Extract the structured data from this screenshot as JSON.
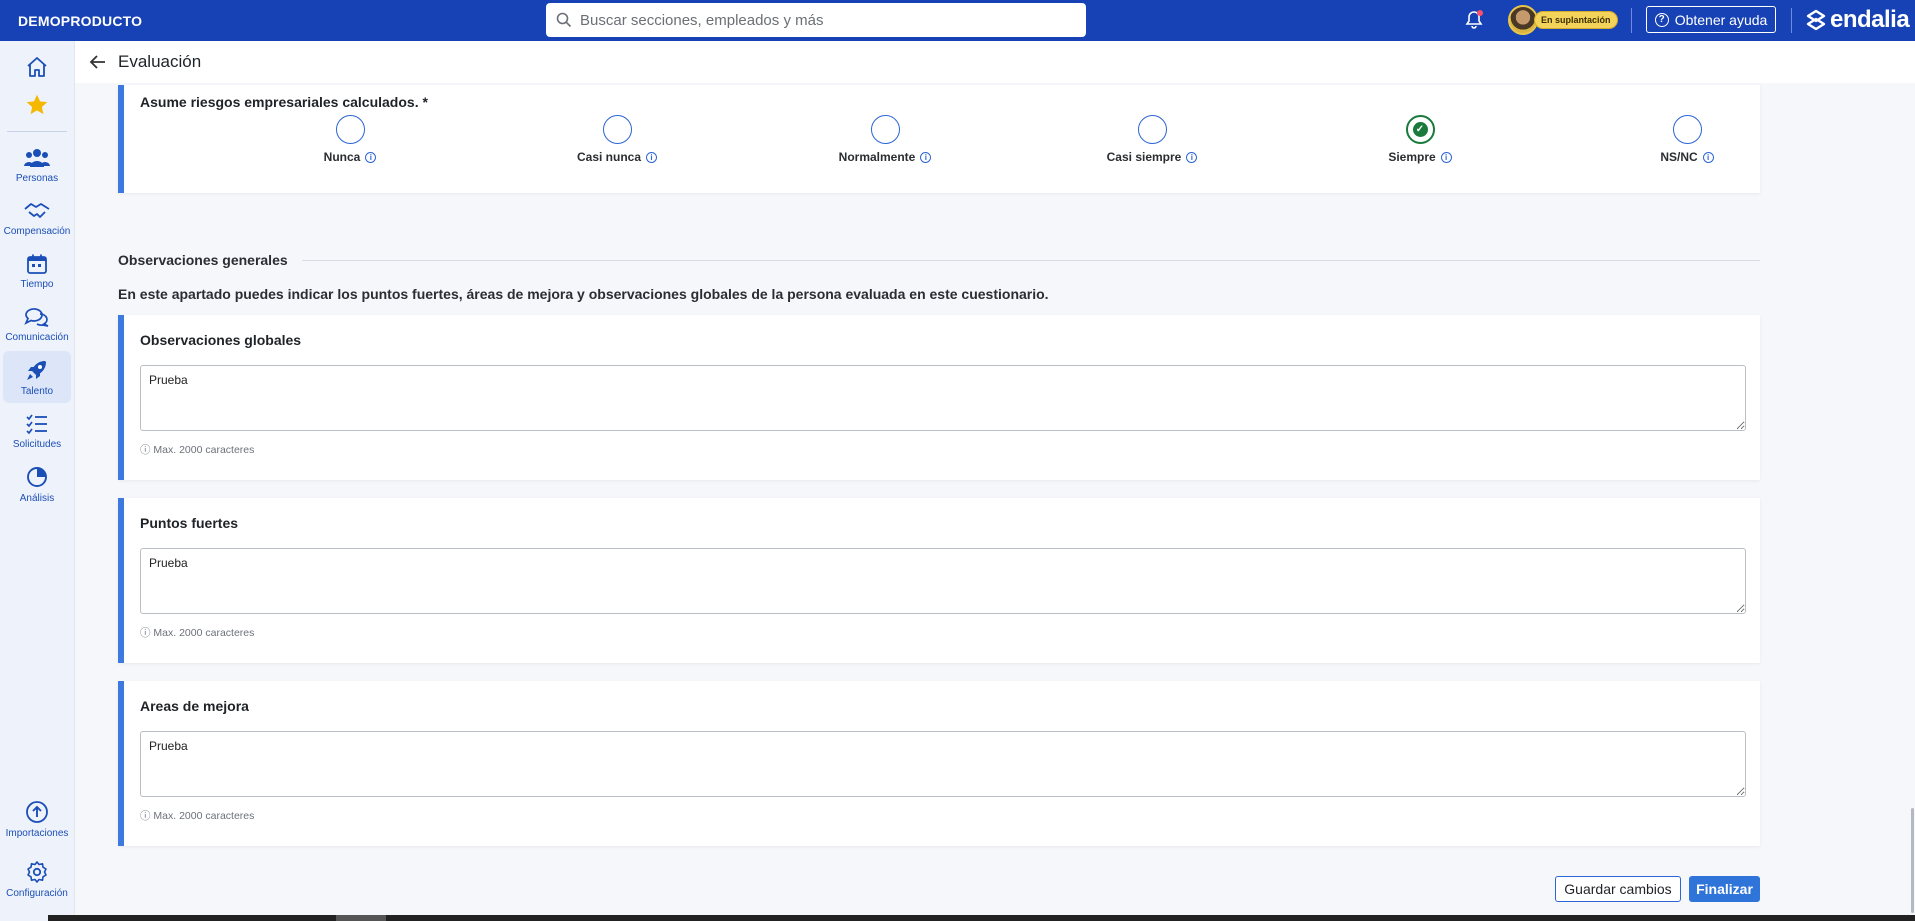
{
  "app": {
    "brand": "DEMOPRODUCTO",
    "logo_text": "endalia"
  },
  "search": {
    "placeholder": "Buscar secciones, empleados y más"
  },
  "topbar": {
    "impersonation_badge": "En suplantación",
    "help_label": "Obtener ayuda"
  },
  "sidebar": {
    "items": [
      {
        "label": "",
        "icon": "home-icon"
      },
      {
        "label": "",
        "icon": "star-icon"
      },
      {
        "label": "Personas",
        "icon": "people-icon"
      },
      {
        "label": "Compensación",
        "icon": "handshake-icon"
      },
      {
        "label": "Tiempo",
        "icon": "calendar-icon"
      },
      {
        "label": "Comunicación",
        "icon": "chat-icon"
      },
      {
        "label": "Talento",
        "icon": "rocket-icon",
        "active": true
      },
      {
        "label": "Solicitudes",
        "icon": "checklist-icon"
      },
      {
        "label": "Análisis",
        "icon": "pie-chart-icon"
      },
      {
        "label": "Importaciones",
        "icon": "upload-icon"
      },
      {
        "label": "Configuración",
        "icon": "gear-icon"
      }
    ]
  },
  "page": {
    "title": "Evaluación"
  },
  "question": {
    "title": "Asume riesgos empresariales calculados. *",
    "options": [
      {
        "label": "Nunca",
        "checked": false
      },
      {
        "label": "Casi nunca",
        "checked": false
      },
      {
        "label": "Normalmente",
        "checked": false
      },
      {
        "label": "Casi siempre",
        "checked": false
      },
      {
        "label": "Siempre",
        "checked": true
      },
      {
        "label": "NS/NC",
        "checked": false
      }
    ]
  },
  "observations": {
    "section_title": "Observaciones generales",
    "description": "En este apartado puedes indicar los puntos fuertes, áreas de mejora y observaciones globales de la persona evaluada en este cuestionario.",
    "fields": [
      {
        "title": "Observaciones globales",
        "value": "Prueba",
        "hint": "ⓘ Max. 2000 caracteres"
      },
      {
        "title": "Puntos fuertes",
        "value": "Prueba",
        "hint": "ⓘ Max. 2000 caracteres"
      },
      {
        "title": "Areas de mejora",
        "value": "Prueba",
        "hint": "ⓘ Max. 2000 caracteres"
      }
    ]
  },
  "actions": {
    "save_label": "Guardar cambios",
    "finish_label": "Finalizar"
  },
  "colors": {
    "topbar": "#1742b5",
    "accent": "#3d7ae0",
    "selected": "#1a7a3c"
  }
}
